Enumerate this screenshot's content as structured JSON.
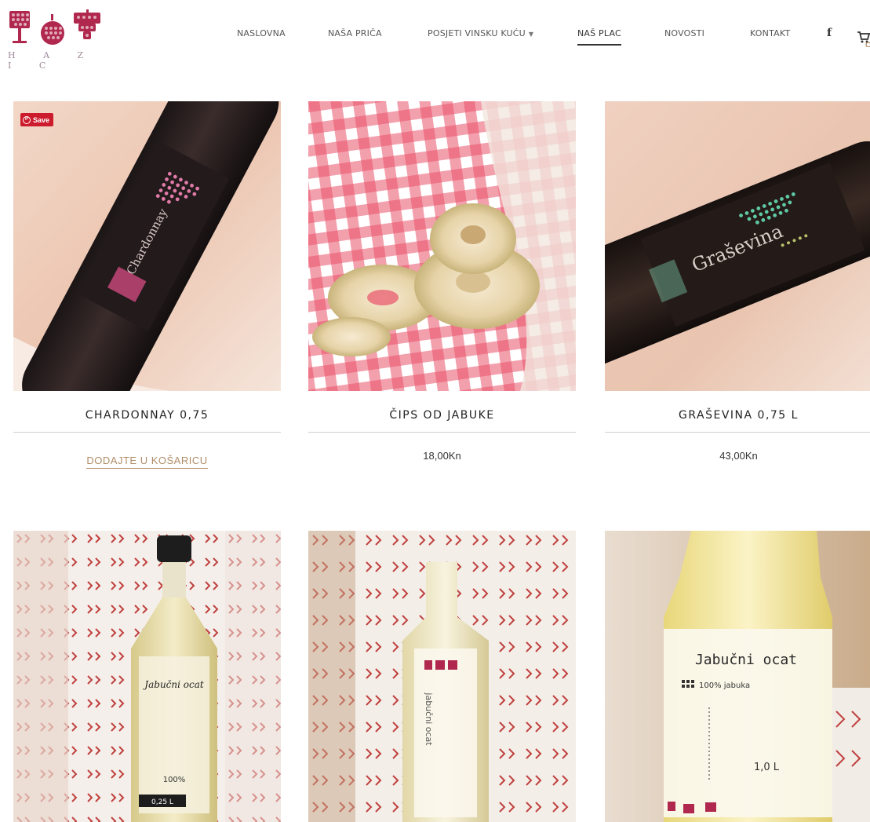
{
  "brand": {
    "wordmark": "H A Z I C",
    "accent_color": "#b0284e"
  },
  "nav": {
    "items": [
      {
        "label": "NASLOVNA",
        "active": false
      },
      {
        "label": "NAŠA PRIČA",
        "active": false
      },
      {
        "label": "POSJETI VINSKU KUĆU",
        "active": false,
        "has_dropdown": true
      },
      {
        "label": "NAŠ PLAC",
        "active": true
      },
      {
        "label": "NOVOSTI",
        "active": false
      },
      {
        "label": "KONTAKT",
        "active": false
      }
    ],
    "facebook_label": "f",
    "facebook_icon": "facebook-icon",
    "cart_icon": "shopping-cart-icon"
  },
  "products": [
    {
      "title": "CHARDONNAY 0,75",
      "action_label": "DODAJTE U KOŠARICU",
      "save_badge": "Save",
      "image": {
        "bottle_text": "Chardonnay",
        "dot_color": "#e07aa8"
      }
    },
    {
      "title": "ČIPS OD JABUKE",
      "price": "18,00Kn",
      "image": {
        "subject": "dried apple chips on gingham cloth"
      }
    },
    {
      "title": "GRAŠEVINA 0,75 L",
      "price": "43,00Kn",
      "image": {
        "bottle_text": "Graševina",
        "dot_color": "#5fc9a6"
      }
    },
    {
      "image": {
        "label_text": "Jabučni ocat",
        "size_text": "0,25 L",
        "percent_text": "100%"
      }
    },
    {
      "image": {
        "label_text": "jabučni ocat"
      }
    },
    {
      "image": {
        "label_text": "Jabučni ocat",
        "sub_text": "100% jabuka",
        "size_text": "1,0 L"
      }
    }
  ],
  "colors": {
    "link_tan": "#b08d68",
    "pin_red": "#cc1b2c"
  }
}
